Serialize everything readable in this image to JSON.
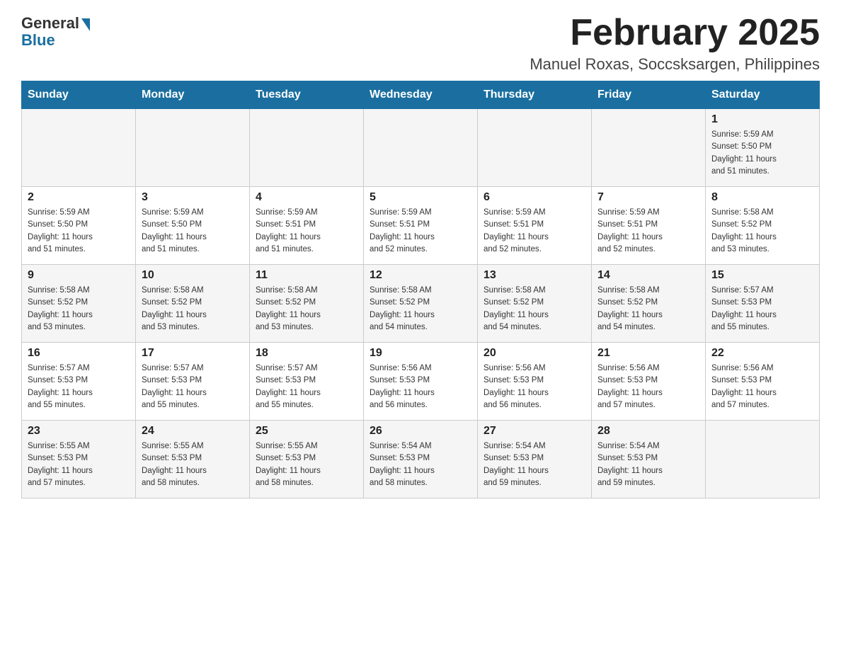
{
  "header": {
    "logo_general": "General",
    "logo_blue": "Blue",
    "month_title": "February 2025",
    "subtitle": "Manuel Roxas, Soccsksargen, Philippines"
  },
  "days_of_week": [
    "Sunday",
    "Monday",
    "Tuesday",
    "Wednesday",
    "Thursday",
    "Friday",
    "Saturday"
  ],
  "weeks": [
    {
      "row": 1,
      "cells": [
        {
          "day": "",
          "info": ""
        },
        {
          "day": "",
          "info": ""
        },
        {
          "day": "",
          "info": ""
        },
        {
          "day": "",
          "info": ""
        },
        {
          "day": "",
          "info": ""
        },
        {
          "day": "",
          "info": ""
        },
        {
          "day": "1",
          "info": "Sunrise: 5:59 AM\nSunset: 5:50 PM\nDaylight: 11 hours\nand 51 minutes."
        }
      ]
    },
    {
      "row": 2,
      "cells": [
        {
          "day": "2",
          "info": "Sunrise: 5:59 AM\nSunset: 5:50 PM\nDaylight: 11 hours\nand 51 minutes."
        },
        {
          "day": "3",
          "info": "Sunrise: 5:59 AM\nSunset: 5:50 PM\nDaylight: 11 hours\nand 51 minutes."
        },
        {
          "day": "4",
          "info": "Sunrise: 5:59 AM\nSunset: 5:51 PM\nDaylight: 11 hours\nand 51 minutes."
        },
        {
          "day": "5",
          "info": "Sunrise: 5:59 AM\nSunset: 5:51 PM\nDaylight: 11 hours\nand 52 minutes."
        },
        {
          "day": "6",
          "info": "Sunrise: 5:59 AM\nSunset: 5:51 PM\nDaylight: 11 hours\nand 52 minutes."
        },
        {
          "day": "7",
          "info": "Sunrise: 5:59 AM\nSunset: 5:51 PM\nDaylight: 11 hours\nand 52 minutes."
        },
        {
          "day": "8",
          "info": "Sunrise: 5:58 AM\nSunset: 5:52 PM\nDaylight: 11 hours\nand 53 minutes."
        }
      ]
    },
    {
      "row": 3,
      "cells": [
        {
          "day": "9",
          "info": "Sunrise: 5:58 AM\nSunset: 5:52 PM\nDaylight: 11 hours\nand 53 minutes."
        },
        {
          "day": "10",
          "info": "Sunrise: 5:58 AM\nSunset: 5:52 PM\nDaylight: 11 hours\nand 53 minutes."
        },
        {
          "day": "11",
          "info": "Sunrise: 5:58 AM\nSunset: 5:52 PM\nDaylight: 11 hours\nand 53 minutes."
        },
        {
          "day": "12",
          "info": "Sunrise: 5:58 AM\nSunset: 5:52 PM\nDaylight: 11 hours\nand 54 minutes."
        },
        {
          "day": "13",
          "info": "Sunrise: 5:58 AM\nSunset: 5:52 PM\nDaylight: 11 hours\nand 54 minutes."
        },
        {
          "day": "14",
          "info": "Sunrise: 5:58 AM\nSunset: 5:52 PM\nDaylight: 11 hours\nand 54 minutes."
        },
        {
          "day": "15",
          "info": "Sunrise: 5:57 AM\nSunset: 5:53 PM\nDaylight: 11 hours\nand 55 minutes."
        }
      ]
    },
    {
      "row": 4,
      "cells": [
        {
          "day": "16",
          "info": "Sunrise: 5:57 AM\nSunset: 5:53 PM\nDaylight: 11 hours\nand 55 minutes."
        },
        {
          "day": "17",
          "info": "Sunrise: 5:57 AM\nSunset: 5:53 PM\nDaylight: 11 hours\nand 55 minutes."
        },
        {
          "day": "18",
          "info": "Sunrise: 5:57 AM\nSunset: 5:53 PM\nDaylight: 11 hours\nand 55 minutes."
        },
        {
          "day": "19",
          "info": "Sunrise: 5:56 AM\nSunset: 5:53 PM\nDaylight: 11 hours\nand 56 minutes."
        },
        {
          "day": "20",
          "info": "Sunrise: 5:56 AM\nSunset: 5:53 PM\nDaylight: 11 hours\nand 56 minutes."
        },
        {
          "day": "21",
          "info": "Sunrise: 5:56 AM\nSunset: 5:53 PM\nDaylight: 11 hours\nand 57 minutes."
        },
        {
          "day": "22",
          "info": "Sunrise: 5:56 AM\nSunset: 5:53 PM\nDaylight: 11 hours\nand 57 minutes."
        }
      ]
    },
    {
      "row": 5,
      "cells": [
        {
          "day": "23",
          "info": "Sunrise: 5:55 AM\nSunset: 5:53 PM\nDaylight: 11 hours\nand 57 minutes."
        },
        {
          "day": "24",
          "info": "Sunrise: 5:55 AM\nSunset: 5:53 PM\nDaylight: 11 hours\nand 58 minutes."
        },
        {
          "day": "25",
          "info": "Sunrise: 5:55 AM\nSunset: 5:53 PM\nDaylight: 11 hours\nand 58 minutes."
        },
        {
          "day": "26",
          "info": "Sunrise: 5:54 AM\nSunset: 5:53 PM\nDaylight: 11 hours\nand 58 minutes."
        },
        {
          "day": "27",
          "info": "Sunrise: 5:54 AM\nSunset: 5:53 PM\nDaylight: 11 hours\nand 59 minutes."
        },
        {
          "day": "28",
          "info": "Sunrise: 5:54 AM\nSunset: 5:53 PM\nDaylight: 11 hours\nand 59 minutes."
        },
        {
          "day": "",
          "info": ""
        }
      ]
    }
  ]
}
